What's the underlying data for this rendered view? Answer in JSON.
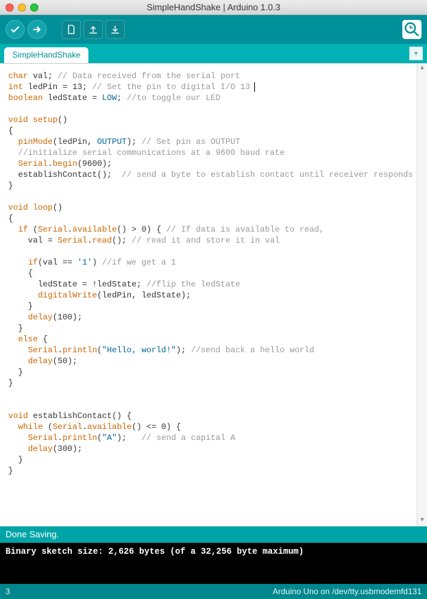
{
  "window": {
    "title": "SimpleHandShake | Arduino 1.0.3"
  },
  "tabs": [
    {
      "label": "SimpleHandShake"
    }
  ],
  "toolbar": {
    "verify": "Verify",
    "upload": "Upload",
    "new": "New",
    "open": "Open",
    "save": "Save",
    "serial_monitor": "Serial Monitor"
  },
  "icons": {
    "check": "✓",
    "arrow_right": "→",
    "doc": "▭",
    "arrow_up": "↑",
    "arrow_down": "↓",
    "chevron": "▾",
    "serial": "🔍"
  },
  "status": {
    "save_message": "Done Saving."
  },
  "console": {
    "line1": "Binary sketch size: 2,626 bytes (of a 32,256 byte maximum)"
  },
  "footer": {
    "line": "3",
    "board": "Arduino Uno on /dev/tty.usbmodemfd131"
  },
  "code": {
    "l1a": "char",
    "l1b": " val; ",
    "l1c": "// Data received from the serial port",
    "l2a": "int",
    "l2b": " ledPin = 13; ",
    "l2c": "// Set the pin to digital I/O 13",
    "l3a": "boolean",
    "l3b": " ledState = ",
    "l3c": "LOW",
    "l3d": "; ",
    "l3e": "//to toggle our LED",
    "l5a": "void",
    "l5b": " ",
    "l5c": "setup",
    "l5d": "()",
    "l6a": "{",
    "l7a": "  ",
    "l7b": "pinMode",
    "l7c": "(ledPin, ",
    "l7d": "OUTPUT",
    "l7e": "); ",
    "l7f": "// Set pin as OUTPUT",
    "l8a": "  ",
    "l8b": "//initialize serial communications at a 9600 baud rate",
    "l9a": "  ",
    "l9b": "Serial",
    "l9c": ".",
    "l9d": "begin",
    "l9e": "(9600);",
    "l10a": "  establishContact();  ",
    "l10b": "// send a byte to establish contact until receiver responds",
    "l11a": "}",
    "l13a": "void",
    "l13b": " ",
    "l13c": "loop",
    "l13d": "()",
    "l14a": "{",
    "l15a": "  ",
    "l15b": "if",
    "l15c": " (",
    "l15d": "Serial",
    "l15e": ".",
    "l15f": "available",
    "l15g": "() > 0) { ",
    "l15h": "// If data is available to read,",
    "l16a": "    val = ",
    "l16b": "Serial",
    "l16c": ".",
    "l16d": "read",
    "l16e": "(); ",
    "l16f": "// read it and store it in val",
    "l18a": "    ",
    "l18b": "if",
    "l18c": "(val == ",
    "l18d": "'1'",
    "l18e": ") ",
    "l18f": "//if we get a 1",
    "l19a": "    {",
    "l20a": "      ledState = !ledState; ",
    "l20b": "//flip the ledState",
    "l21a": "      ",
    "l21b": "digitalWrite",
    "l21c": "(ledPin, ledState);",
    "l22a": "    }",
    "l23a": "    ",
    "l23b": "delay",
    "l23c": "(100);",
    "l24a": "  }",
    "l25a": "  ",
    "l25b": "else",
    "l25c": " {",
    "l26a": "    ",
    "l26b": "Serial",
    "l26c": ".",
    "l26d": "println",
    "l26e": "(",
    "l26f": "\"Hello, world!\"",
    "l26g": "); ",
    "l26h": "//send back a hello world",
    "l27a": "    ",
    "l27b": "delay",
    "l27c": "(50);",
    "l28a": "  }",
    "l29a": "}",
    "l32a": "void",
    "l32b": " establishContact() {",
    "l33a": "  ",
    "l33b": "while",
    "l33c": " (",
    "l33d": "Serial",
    "l33e": ".",
    "l33f": "available",
    "l33g": "() <= 0) {",
    "l34a": "    ",
    "l34b": "Serial",
    "l34c": ".",
    "l34d": "println",
    "l34e": "(",
    "l34f": "\"A\"",
    "l34g": ");   ",
    "l34h": "// send a capital A",
    "l35a": "    ",
    "l35b": "delay",
    "l35c": "(300);",
    "l36a": "  }",
    "l37a": "}"
  }
}
